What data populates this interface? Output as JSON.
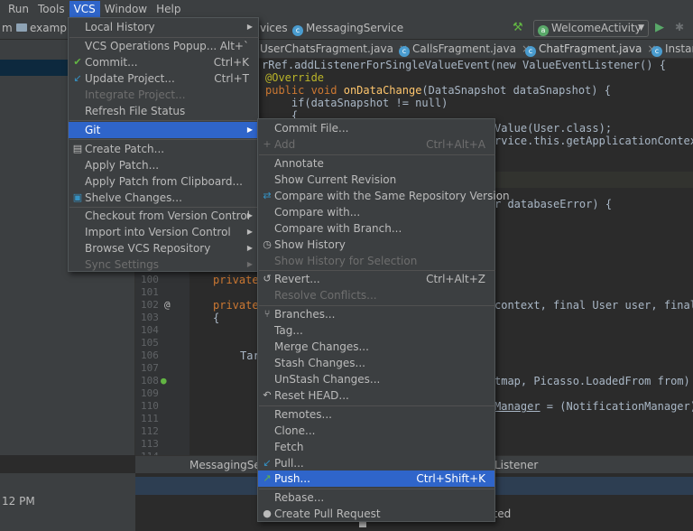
{
  "menubar": {
    "items": [
      "Run",
      "Tools",
      "VCS",
      "Window",
      "Help"
    ],
    "active": "VCS"
  },
  "navbar": {
    "crumb_left": "m",
    "crumb_folder": "exampl",
    "crumb_services": "vices",
    "crumb_messaging": "MessagingService",
    "run_config": "WelcomeActivity"
  },
  "tabs": [
    "UserChatsFragment.java",
    "CallsFragment.java",
    "ChatFragment.java",
    "Instan"
  ],
  "code_lines": {
    "l1": "rRef.addListenerForSingleValueEvent(new ValueEventListener() {",
    "l2": "@Override",
    "l3_kw": "public void",
    "l3_fn": "onDataChange",
    "l3_rest": "(DataSnapshot dataSnapshot) {",
    "l4": "    if(dataSnapshot != null)",
    "l5": "    {",
    "l6": "Value(User.class);",
    "l7": "rvice.this.getApplicationContext",
    "l8": "r databaseError) {",
    "l9": "context, final User user, final",
    "l10": "tmap, Picasso.LoadedFrom from) {",
    "l11_a": "Manager",
    "l11_b": " = (NotificationManager)",
    "private1": "private",
    "private2": "private",
    "brace": "{",
    "tar": "Tar"
  },
  "gutter": {
    "line_numbers": [
      "100",
      "101",
      "102",
      "103",
      "104",
      "105",
      "106",
      "107",
      "108",
      "109",
      "110",
      "111",
      "112",
      "113",
      "114"
    ],
    "at_marker": "@"
  },
  "bottom": {
    "tab1": "MessagingSer",
    "tab2": "Listener",
    "time": "12 PM",
    "status": "cted"
  },
  "vcs_menu": {
    "items": [
      {
        "label": "Local History",
        "submenu": true
      },
      {
        "label": "VCS Operations Popup...",
        "shortcut": "Alt+`"
      },
      {
        "label": "Commit...",
        "shortcut": "Ctrl+K",
        "icon": "check-icon"
      },
      {
        "label": "Update Project...",
        "shortcut": "Ctrl+T",
        "icon": "update-arrow-icon"
      },
      {
        "label": "Integrate Project...",
        "disabled": true
      },
      {
        "label": "Refresh File Status"
      },
      {
        "label": "Git",
        "submenu": true,
        "selected": true
      },
      {
        "label": "Create Patch...",
        "icon": "patch-icon"
      },
      {
        "label": "Apply Patch..."
      },
      {
        "label": "Apply Patch from Clipboard..."
      },
      {
        "label": "Shelve Changes...",
        "icon": "shelve-icon"
      },
      {
        "label": "Checkout from Version Control",
        "submenu": true
      },
      {
        "label": "Import into Version Control",
        "submenu": true
      },
      {
        "label": "Browse VCS Repository",
        "submenu": true
      },
      {
        "label": "Sync Settings",
        "submenu": true,
        "disabled": true
      }
    ]
  },
  "git_menu": {
    "items": [
      {
        "label": "Commit File..."
      },
      {
        "label": "Add",
        "shortcut": "Ctrl+Alt+A",
        "disabled": true
      },
      {
        "label": "Annotate"
      },
      {
        "label": "Show Current Revision"
      },
      {
        "label": "Compare with the Same Repository Version",
        "icon": "compare-icon"
      },
      {
        "label": "Compare with..."
      },
      {
        "label": "Compare with Branch..."
      },
      {
        "label": "Show History",
        "icon": "history-clock-icon"
      },
      {
        "label": "Show History for Selection",
        "disabled": true
      },
      {
        "label": "Revert...",
        "shortcut": "Ctrl+Alt+Z",
        "icon": "revert-icon"
      },
      {
        "label": "Resolve Conflicts...",
        "disabled": true
      },
      {
        "label": "Branches...",
        "icon": "branch-icon"
      },
      {
        "label": "Tag..."
      },
      {
        "label": "Merge Changes..."
      },
      {
        "label": "Stash Changes..."
      },
      {
        "label": "UnStash Changes..."
      },
      {
        "label": "Reset HEAD...",
        "icon": "reset-icon"
      },
      {
        "label": "Remotes..."
      },
      {
        "label": "Clone..."
      },
      {
        "label": "Fetch"
      },
      {
        "label": "Pull...",
        "icon": "pull-icon"
      },
      {
        "label": "Push...",
        "shortcut": "Ctrl+Shift+K",
        "selected": true,
        "icon": "push-icon"
      },
      {
        "label": "Rebase..."
      },
      {
        "label": "Create Pull Request",
        "icon": "github-icon"
      }
    ]
  },
  "colors": {
    "selection": "#2f65ca",
    "menu_bg": "#3c3f41",
    "editor_bg": "#2b2b2b",
    "keyword": "#cc7832",
    "annotation": "#bbb529",
    "function": "#ffc66d"
  }
}
